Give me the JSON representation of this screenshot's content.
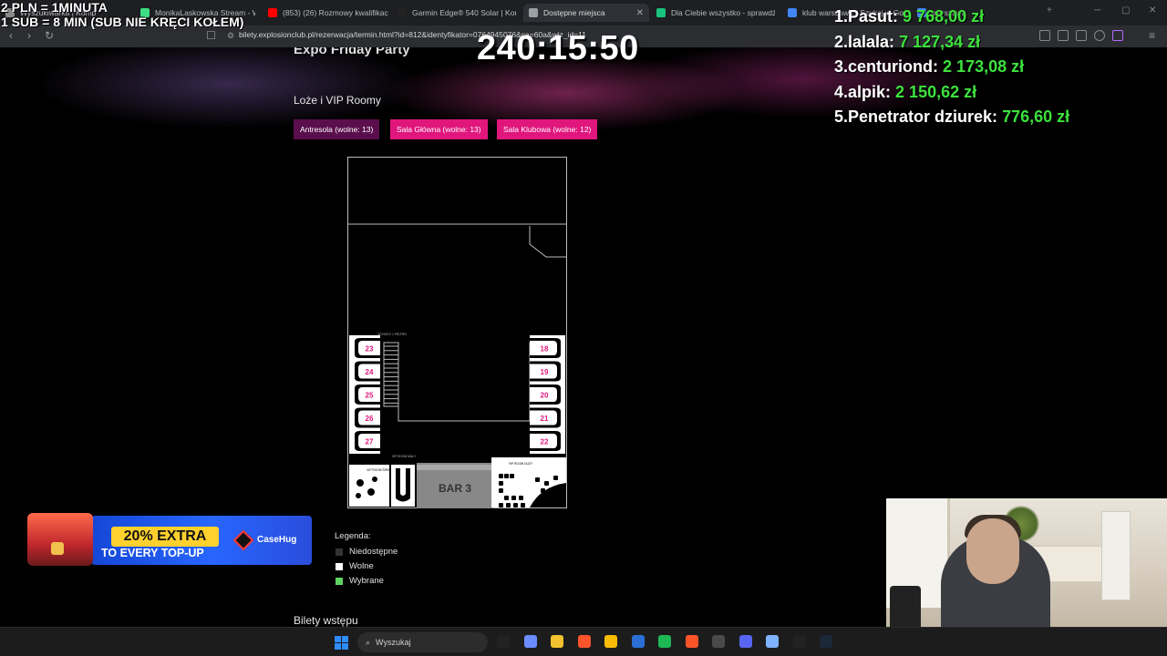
{
  "browser": {
    "tabs": [
      {
        "label": "Wyszukiwarka | Komp",
        "color": "#8a8a8a"
      },
      {
        "label": "MonikaLaskowska Stream - Wat",
        "color": "#3ddc84"
      },
      {
        "label": "(853) (26) Rozmowy kwalifikac",
        "color": "#ff0000"
      },
      {
        "label": "Garmin Edge® 540 Solar | Kom",
        "color": "#222222"
      },
      {
        "label": "Dostępne miejsca",
        "color": "#9aa0a6",
        "active": true
      },
      {
        "label": "Dla Ciebie wszystko - sprawdź",
        "color": "#19c37d"
      },
      {
        "label": "klub warszawa - Szukaj w Goo",
        "color": "#4285f4"
      },
      {
        "label": "warszawa",
        "color": "#4285f4"
      }
    ],
    "new_tab": "+",
    "url": "bilety.explosionclub.pl/rezerwacja/termin.html?id=812&identyfikator=0764945076&ca=60a&wiz_id=11"
  },
  "page": {
    "event_title": "Expo Friday Party",
    "section_title": "Loże i VIP Roomy",
    "room_tabs": [
      {
        "label": "Antresola (wolne: 13)"
      },
      {
        "label": "Sala Główna (wolne: 13)"
      },
      {
        "label": "Sala Klubowa (wolne: 12)"
      }
    ],
    "floorplan": {
      "left_booths": [
        "23",
        "24",
        "25",
        "26",
        "27"
      ],
      "right_booths": [
        "18",
        "19",
        "20",
        "21",
        "22"
      ],
      "bar_label": "BAR 3",
      "vip_left": "VIP ROOM ŚREDNI",
      "vip_center": "VIP ROOM MAŁY",
      "vip_right": "VIP ROOM DUŻY",
      "stairs_label": "SCHODY 1 PIĘTRO",
      "booth_color": "#e0167d"
    },
    "legend": {
      "title": "Legenda:",
      "items": [
        {
          "label": "Niedostępne",
          "color": "#333333"
        },
        {
          "label": "Wolne",
          "color": "#ffffff"
        },
        {
          "label": "Wybrane",
          "color": "#5fd35f"
        }
      ]
    },
    "tickets_title": "Bilety wstępu"
  },
  "overlay": {
    "rules_line1": "2 PLN = 1MINUTA",
    "rules_line2": "1 SUB = 8 MIN (SUB NIE KRĘCI KOŁEM)",
    "timer": "240:15:50",
    "leaderboard": [
      {
        "rank": "1.",
        "name": "Pasut:",
        "amount": "9 768,00 zł"
      },
      {
        "rank": "2.",
        "name": "lalala:",
        "amount": "7 127,34 zł"
      },
      {
        "rank": "3.",
        "name": "centuriond:",
        "amount": "2 173,08 zł"
      },
      {
        "rank": "4.",
        "name": "alpik:",
        "amount": "2 150,62 zł"
      },
      {
        "rank": "5.",
        "name": "Penetrator dziurek:",
        "amount": "776,60 zł"
      }
    ],
    "leaderboard_amount_color": "#3de23d",
    "ad": {
      "headline": "20% EXTRA",
      "subline": "TO EVERY TOP-UP",
      "brand": "CaseHug"
    }
  },
  "taskbar": {
    "search_placeholder": "Wyszukaj"
  }
}
